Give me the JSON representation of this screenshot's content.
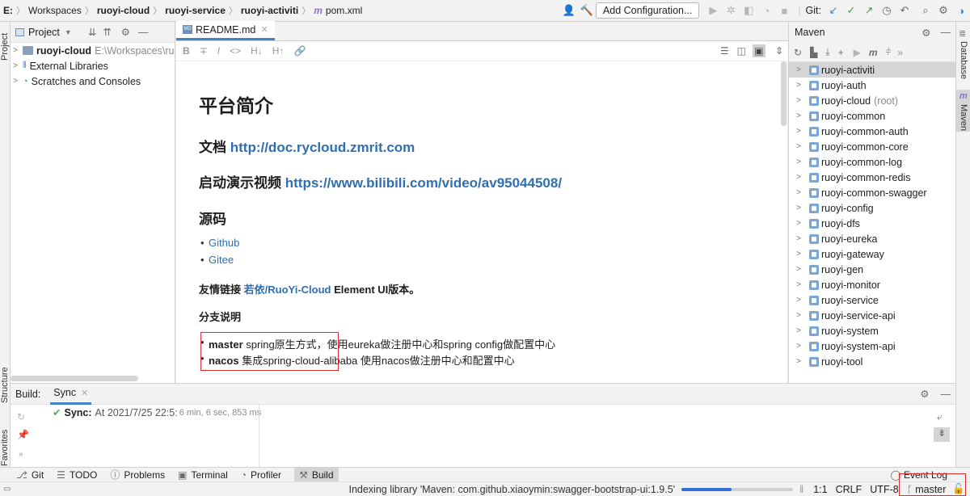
{
  "navbar": {
    "breadcrumbs": [
      "E:",
      "Workspaces",
      "ruoyi-cloud",
      "ruoyi-service",
      "ruoyi-activiti",
      "pom.xml"
    ],
    "add_configuration": "Add Configuration...",
    "git_label": "Git:"
  },
  "left_stripe": {
    "project": "Project",
    "structure": "Structure",
    "favorites": "Favorites"
  },
  "project_panel": {
    "title": "Project",
    "items": [
      {
        "label": "ruoyi-cloud",
        "path": "E:\\Workspaces\\ru"
      },
      {
        "label": "External Libraries"
      },
      {
        "label": "Scratches and Consoles"
      }
    ]
  },
  "editor": {
    "tab": "README.md",
    "toolbar": [
      "B",
      "∓",
      "I",
      "<>",
      "H↓",
      "H↑",
      "🔗"
    ],
    "h1": "平台简介",
    "doc_label": "文档",
    "doc_link": "http://doc.rycloud.zmrit.com",
    "video_label": "启动演示视频",
    "video_link": "https://www.bilibili.com/video/av95044508/",
    "source_title": "源码",
    "source_items": [
      "Github",
      "Gitee"
    ],
    "friend_prefix": "友情链接",
    "friend_link": "若依/RuoYi-Cloud",
    "friend_suffix": "Element UI版本。",
    "branch_title": "分支说明",
    "branches": [
      {
        "name": "master",
        "desc": "spring原生方式，使用eureka做注册中心和spring config做配置中心"
      },
      {
        "name": "nacos",
        "desc": "集成spring-cloud-alibaba 使用nacos做注册中心和配置中心"
      }
    ]
  },
  "maven": {
    "title": "Maven",
    "items": [
      {
        "label": "ruoyi-activiti",
        "selected": true
      },
      {
        "label": "ruoyi-auth"
      },
      {
        "label": "ruoyi-cloud",
        "note": "(root)"
      },
      {
        "label": "ruoyi-common"
      },
      {
        "label": "ruoyi-common-auth"
      },
      {
        "label": "ruoyi-common-core"
      },
      {
        "label": "ruoyi-common-log"
      },
      {
        "label": "ruoyi-common-redis"
      },
      {
        "label": "ruoyi-common-swagger"
      },
      {
        "label": "ruoyi-config"
      },
      {
        "label": "ruoyi-dfs"
      },
      {
        "label": "ruoyi-eureka"
      },
      {
        "label": "ruoyi-gateway"
      },
      {
        "label": "ruoyi-gen"
      },
      {
        "label": "ruoyi-monitor"
      },
      {
        "label": "ruoyi-service"
      },
      {
        "label": "ruoyi-service-api"
      },
      {
        "label": "ruoyi-system"
      },
      {
        "label": "ruoyi-system-api"
      },
      {
        "label": "ruoyi-tool"
      }
    ]
  },
  "right_stripe": {
    "database": "Database",
    "maven": "Maven"
  },
  "build": {
    "label": "Build:",
    "tab": "Sync",
    "sync_title": "Sync:",
    "sync_text": "At 2021/7/25 22:5:",
    "sync_time": "6 min, 6 sec, 853 ms"
  },
  "tool_windows": [
    "Git",
    "TODO",
    "Problems",
    "Terminal",
    "Profiler",
    "Build"
  ],
  "event_log": "Event Log",
  "status": {
    "indexing": "Indexing library 'Maven: com.github.xiaoymin:swagger-bootstrap-ui:1.9.5'",
    "progress": 0.45,
    "position": "1:1",
    "line_sep": "CRLF",
    "encoding": "UTF-8",
    "branch": "master"
  },
  "colors": {
    "accent": "#4083c9",
    "link": "#2f6fb0",
    "highlight_box": "#d9302e",
    "check": "#4caf50"
  }
}
